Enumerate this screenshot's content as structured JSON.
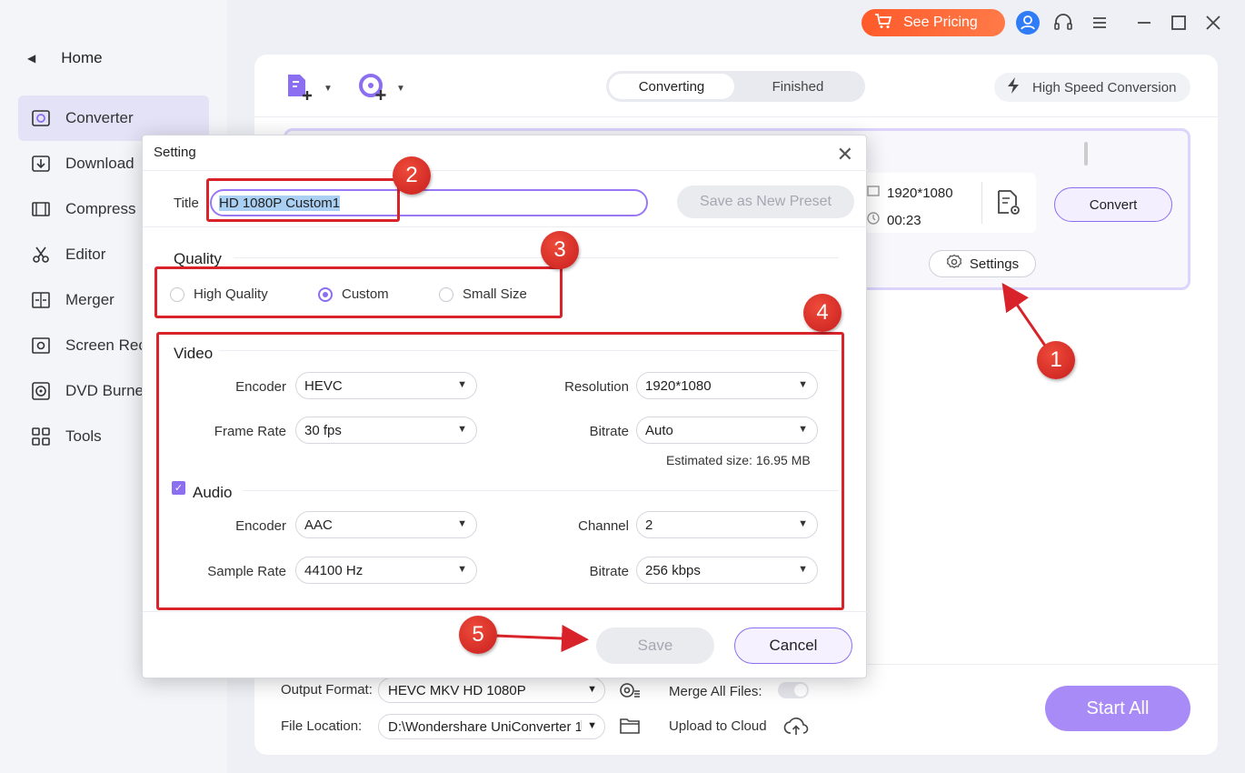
{
  "sidebar": {
    "home_label": "Home",
    "items": [
      {
        "label": "Converter",
        "icon": "converter-icon"
      },
      {
        "label": "Download",
        "icon": "download-icon"
      },
      {
        "label": "Compress",
        "icon": "compress-icon"
      },
      {
        "label": "Editor",
        "icon": "scissors-icon"
      },
      {
        "label": "Merger",
        "icon": "merger-icon"
      },
      {
        "label": "Screen Rec",
        "icon": "screen-record-icon"
      },
      {
        "label": "DVD Burne",
        "icon": "dvd-icon"
      },
      {
        "label": "Tools",
        "icon": "tools-icon"
      }
    ]
  },
  "topbar": {
    "pricing_label": "See Pricing"
  },
  "toolbar": {
    "tab_converting": "Converting",
    "tab_finished": "Finished",
    "high_speed_label": "High Speed Conversion"
  },
  "file": {
    "resolution": "1920*1080",
    "duration": "00:23",
    "convert_label": "Convert",
    "settings_label": "Settings"
  },
  "bottom": {
    "output_format_label": "Output Format:",
    "output_format_value": "HEVC MKV HD 1080P",
    "merge_label": "Merge All Files:",
    "file_location_label": "File Location:",
    "file_location_value": "D:\\Wondershare UniConverter 1",
    "upload_label": "Upload to Cloud",
    "start_all_label": "Start All"
  },
  "modal": {
    "title": "Setting",
    "title_label": "Title",
    "title_value": "HD 1080P Custom1",
    "save_preset_label": "Save as New Preset",
    "quality_label": "Quality",
    "quality_options": [
      "High Quality",
      "Custom",
      "Small Size"
    ],
    "quality_selected": "Custom",
    "video_label": "Video",
    "video": {
      "encoder_label": "Encoder",
      "encoder_value": "HEVC",
      "resolution_label": "Resolution",
      "resolution_value": "1920*1080",
      "framerate_label": "Frame Rate",
      "framerate_value": "30 fps",
      "bitrate_label": "Bitrate",
      "bitrate_value": "Auto",
      "estimated_size": "Estimated size: 16.95 MB"
    },
    "audio_label": "Audio",
    "audio": {
      "encoder_label": "Encoder",
      "encoder_value": "AAC",
      "channel_label": "Channel",
      "channel_value": "2",
      "samplerate_label": "Sample Rate",
      "samplerate_value": "44100 Hz",
      "bitrate_label": "Bitrate",
      "bitrate_value": "256 kbps"
    },
    "save_label": "Save",
    "cancel_label": "Cancel"
  },
  "annotations": [
    "1",
    "2",
    "3",
    "4",
    "5"
  ],
  "colors": {
    "accent": "#8b6ff0",
    "annotation_red": "#d8232a",
    "pricing_orange": "#ff5a2a",
    "start_all": "#a98bf7"
  }
}
